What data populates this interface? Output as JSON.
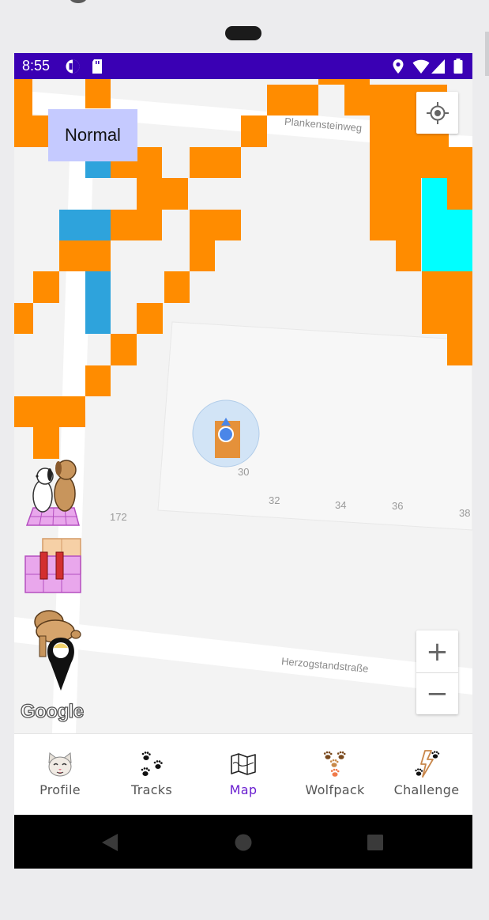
{
  "status_bar": {
    "time": "8:55",
    "left_icons": [
      "data-saver-icon",
      "sd-card-icon"
    ],
    "right_icons": [
      "location-icon",
      "wifi-icon",
      "signal-icon",
      "battery-icon"
    ],
    "background": "#3a00b4"
  },
  "map": {
    "mode_label": "Normal",
    "street_labels": [
      "Plankensteinweg",
      "Herzogstandstraße"
    ],
    "house_numbers": [
      "30",
      "32",
      "34",
      "36",
      "38",
      "172"
    ],
    "attribution": "Google",
    "colors": {
      "tile_orange": "#ff8c00",
      "tile_blue": "#2ea3dc",
      "tile_cyan": "#00ffff",
      "chip": "#c5caff"
    },
    "controls": {
      "my_location": "my-location-icon",
      "zoom_in": "+",
      "zoom_out": "−"
    }
  },
  "side_actions": [
    "wolfpack-dogs-icon",
    "pause-tiles-icon",
    "dog-marker-icon"
  ],
  "bottom_nav": {
    "active": "Map",
    "active_color": "#6a1fd0",
    "items": [
      {
        "label": "Profile",
        "icon": "cat-face-icon"
      },
      {
        "label": "Tracks",
        "icon": "paw-prints-icon"
      },
      {
        "label": "Map",
        "icon": "map-icon"
      },
      {
        "label": "Wolfpack",
        "icon": "paws-group-icon"
      },
      {
        "label": "Challenge",
        "icon": "lightning-paw-icon"
      }
    ]
  },
  "system_nav": [
    "back-icon",
    "home-icon",
    "recents-icon"
  ]
}
